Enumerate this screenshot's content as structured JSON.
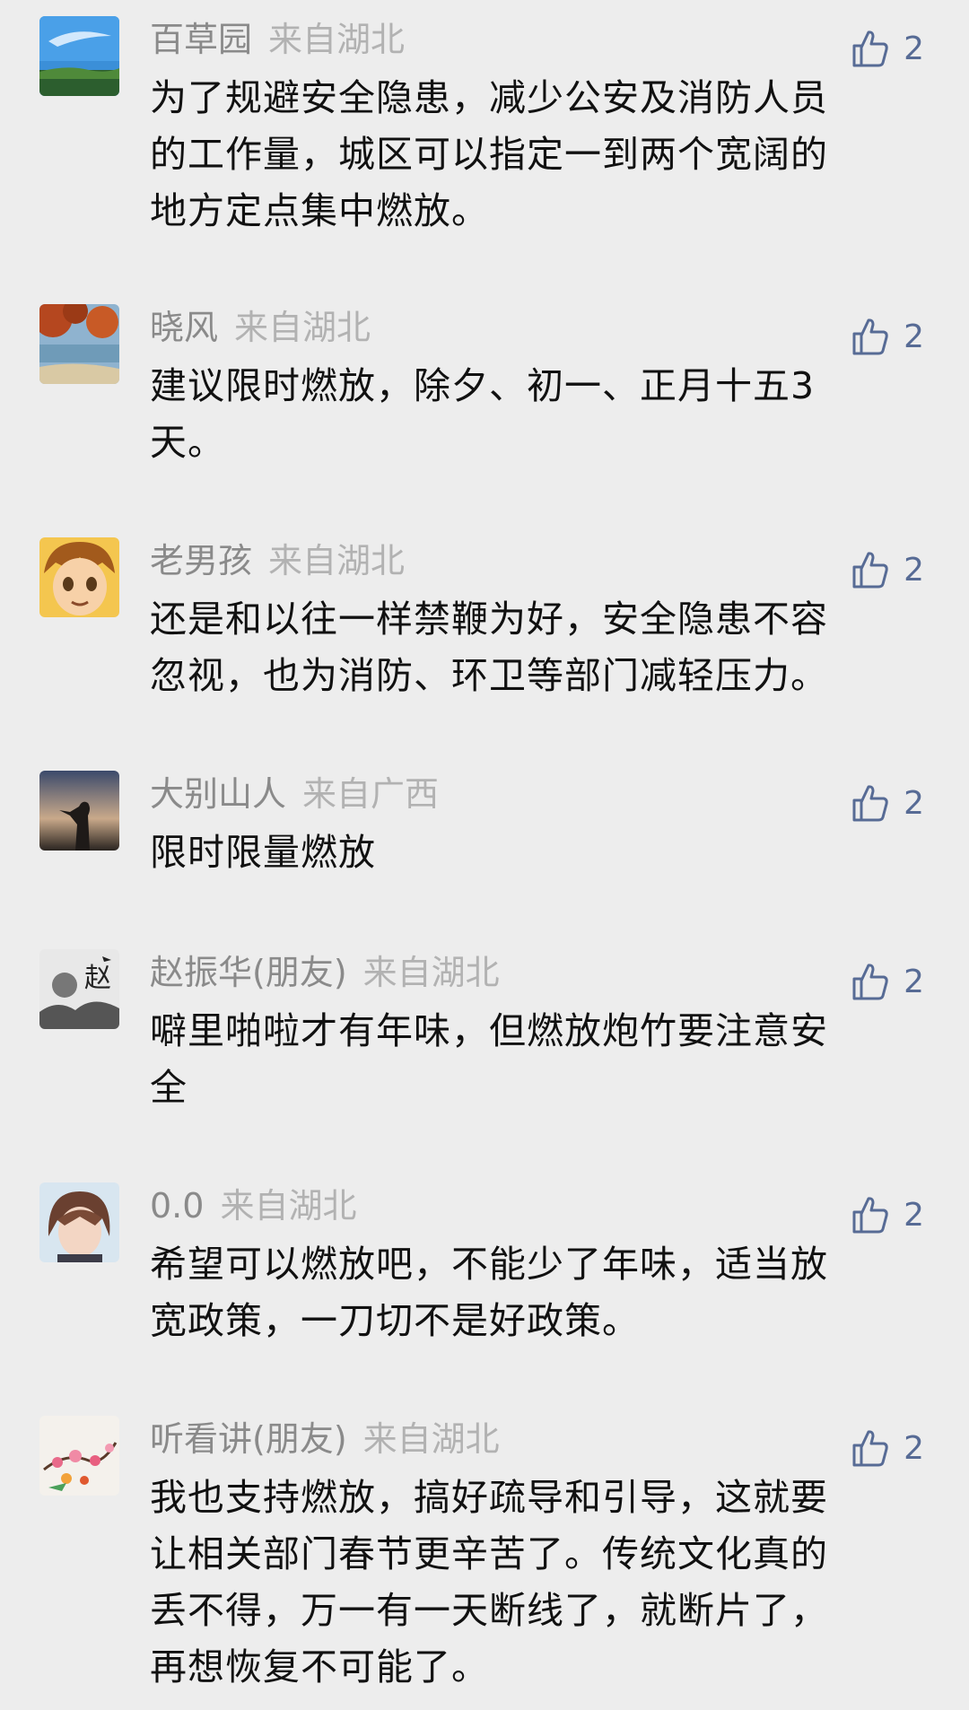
{
  "comments": [
    {
      "name": "百草园",
      "location": "来自湖北",
      "likes": "2",
      "lines": [
        "为了规避安全隐患，减少公安及消防人员",
        "的工作量，城区可以指定一到两个宽阔的",
        "地方定点集中燃放。"
      ],
      "avatar": "sky-landscape-avatar"
    },
    {
      "name": "晓风",
      "location": "来自湖北",
      "likes": "2",
      "lines": [
        "建议限时燃放，除夕、初一、正月十五3",
        "天。"
      ],
      "avatar": "autumn-lake-avatar"
    },
    {
      "name": "老男孩",
      "location": "来自湖北",
      "likes": "2",
      "lines": [
        "还是和以往一样禁鞭为好，安全隐患不容",
        "忽视，也为消防、环卫等部门减轻压力。"
      ],
      "avatar": "cartoon-boy-avatar"
    },
    {
      "name": "大别山人",
      "location": "来自广西",
      "likes": "2",
      "lines": [
        "限时限量燃放"
      ],
      "avatar": "silhouette-sunset-avatar"
    },
    {
      "name": "赵振华(朋友)",
      "location": "来自湖北",
      "likes": "2",
      "lines": [
        "噼里啪啦才有年味，但燃放炮竹要注意安",
        "全"
      ],
      "avatar": "calligraphy-zhao-avatar",
      "avatar_text": "赵"
    },
    {
      "name": "0.0",
      "location": "来自湖北",
      "likes": "2",
      "lines": [
        "希望可以燃放吧，不能少了年味，适当放",
        "宽政策，一刀切不是好政策。"
      ],
      "avatar": "portrait-avatar"
    },
    {
      "name": "听看讲(朋友)",
      "location": "来自湖北",
      "likes": "2",
      "lines": [
        "我也支持燃放，搞好疏导和引导，这就要",
        "让相关部门春节更辛苦了。传统文化真的",
        "丢不得，万一有一天断线了，就断片了，",
        "再想恢复不可能了。"
      ],
      "avatar": "plum-blossom-avatar"
    }
  ],
  "colors": {
    "background": "#ededed",
    "like_blue": "#576b95",
    "name_gray": "#8a8a8a",
    "location_gray": "#b2b2b2"
  }
}
